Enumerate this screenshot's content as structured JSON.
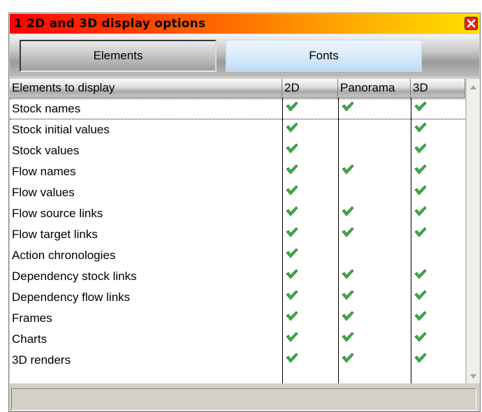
{
  "window": {
    "title": "1  2D and 3D display options"
  },
  "tabs": [
    {
      "label": "Elements",
      "active": true
    },
    {
      "label": "Fonts",
      "active": false
    }
  ],
  "grid": {
    "columns": [
      "Elements to display",
      "2D",
      "Panorama",
      "3D"
    ],
    "rows": [
      {
        "name": "Stock names",
        "d2": true,
        "panorama": true,
        "d3": true
      },
      {
        "name": "Stock initial values",
        "d2": true,
        "panorama": false,
        "d3": true
      },
      {
        "name": "Stock values",
        "d2": true,
        "panorama": false,
        "d3": true
      },
      {
        "name": "Flow names",
        "d2": true,
        "panorama": true,
        "d3": true
      },
      {
        "name": "Flow values",
        "d2": true,
        "panorama": false,
        "d3": true
      },
      {
        "name": "Flow source links",
        "d2": true,
        "panorama": true,
        "d3": true
      },
      {
        "name": "Flow target links",
        "d2": true,
        "panorama": true,
        "d3": true
      },
      {
        "name": "Action chronologies",
        "d2": true,
        "panorama": false,
        "d3": false
      },
      {
        "name": "Dependency stock links",
        "d2": true,
        "panorama": true,
        "d3": true
      },
      {
        "name": "Dependency flow links",
        "d2": true,
        "panorama": true,
        "d3": true
      },
      {
        "name": "Frames",
        "d2": true,
        "panorama": true,
        "d3": true
      },
      {
        "name": "Charts",
        "d2": true,
        "panorama": true,
        "d3": true
      },
      {
        "name": "3D renders",
        "d2": true,
        "panorama": true,
        "d3": true
      }
    ]
  },
  "colors": {
    "check": "#3cb043",
    "title_gradient_start": "#ff0000",
    "title_gradient_end": "#ffe000"
  },
  "icons": {
    "close": "close-icon",
    "check": "check-icon",
    "scroll_up": "scroll-up-arrow-icon",
    "scroll_down": "scroll-down-arrow-icon"
  }
}
